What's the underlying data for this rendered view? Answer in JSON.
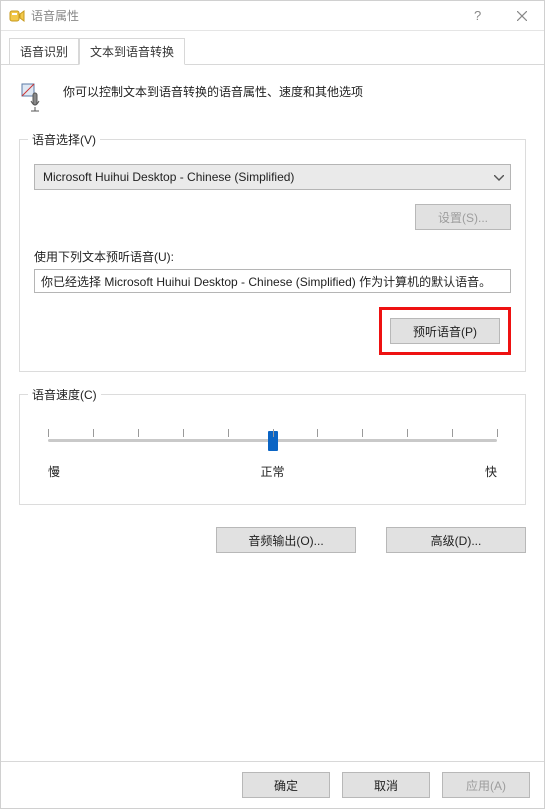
{
  "window": {
    "title": "语音属性"
  },
  "tabs": {
    "recognition": "语音识别",
    "tts": "文本到语音转换",
    "active": "tts"
  },
  "intro": {
    "text": "你可以控制文本到语音转换的语音属性、速度和其他选项"
  },
  "voice_select": {
    "legend": "语音选择(V)",
    "selected": "Microsoft Huihui Desktop - Chinese (Simplified)",
    "settings_btn": "设置(S)...",
    "settings_enabled": false,
    "preview_label": "使用下列文本预听语音(U):",
    "preview_text": "你已经选择 Microsoft Huihui Desktop - Chinese (Simplified) 作为计算机的默认语音。",
    "preview_btn": "预听语音(P)"
  },
  "speed": {
    "legend": "语音速度(C)",
    "value": 5,
    "min": 0,
    "max": 10,
    "labels": {
      "slow": "慢",
      "normal": "正常",
      "fast": "快"
    }
  },
  "buttons": {
    "audio_output": "音频输出(O)...",
    "advanced": "高级(D)..."
  },
  "footer": {
    "ok": "确定",
    "cancel": "取消",
    "apply": "应用(A)",
    "apply_enabled": false
  }
}
